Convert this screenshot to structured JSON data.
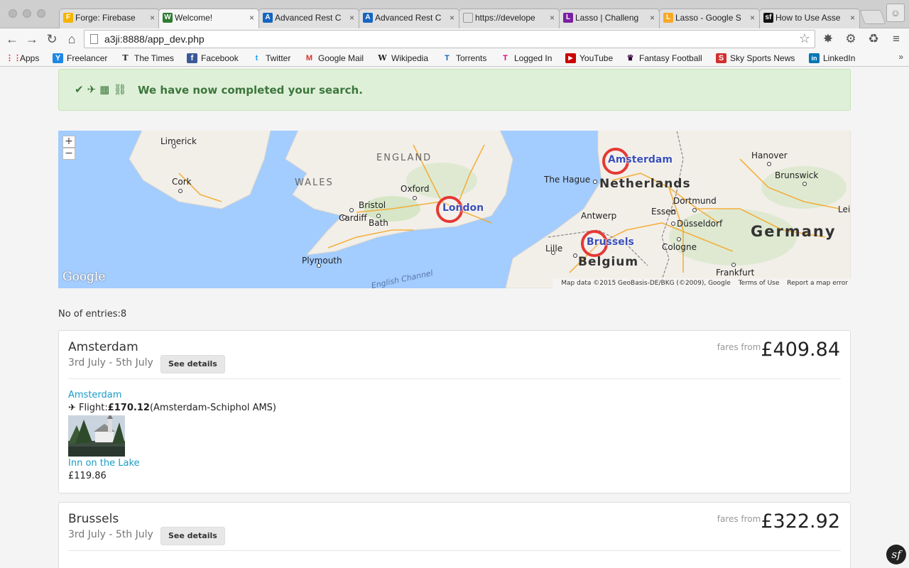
{
  "browser": {
    "tabs": [
      {
        "title": "Forge: Firebase",
        "fav": "F",
        "fav_color": "#f5b400"
      },
      {
        "title": "Welcome!",
        "fav": "W",
        "fav_color": "#2e7d32"
      },
      {
        "title": "Advanced Rest C",
        "fav": "A",
        "fav_color": "#1565c0"
      },
      {
        "title": "Advanced Rest C",
        "fav": "A",
        "fav_color": "#1565c0"
      },
      {
        "title": "https://develope",
        "fav": "",
        "fav_color": "#ffffff"
      },
      {
        "title": "Lasso | Challeng",
        "fav": "L",
        "fav_color": "#7b1fa2"
      },
      {
        "title": "Lasso - Google S",
        "fav": "L",
        "fav_color": "#f9a825"
      },
      {
        "title": "How to Use Asse",
        "fav": "sf",
        "fav_color": "#111111"
      }
    ],
    "close_glyph": "×",
    "url": "a3ji:8888/app_dev.php",
    "bookmarks": [
      {
        "label": "Apps",
        "icon": "apps-icon",
        "glyph": "⋮⋮",
        "color": "#e53935"
      },
      {
        "label": "Freelancer",
        "icon": "freelancer-icon",
        "glyph": "Y",
        "color": "#1e88e5"
      },
      {
        "label": "The Times",
        "icon": "times-icon",
        "glyph": "T",
        "color": "#222222"
      },
      {
        "label": "Facebook",
        "icon": "facebook-icon",
        "glyph": "f",
        "color": "#3b5998"
      },
      {
        "label": "Twitter",
        "icon": "twitter-icon",
        "glyph": "t",
        "color": "#1da1f2"
      },
      {
        "label": "Google Mail",
        "icon": "gmail-icon",
        "glyph": "M",
        "color": "#d93025"
      },
      {
        "label": "Wikipedia",
        "icon": "wikipedia-icon",
        "glyph": "W",
        "color": "#222222"
      },
      {
        "label": "Torrents",
        "icon": "torrents-icon",
        "glyph": "T",
        "color": "#1565c0"
      },
      {
        "label": "Logged In",
        "icon": "loggedin-icon",
        "glyph": "T",
        "color": "#e2007a"
      },
      {
        "label": "YouTube",
        "icon": "youtube-icon",
        "glyph": "▶",
        "color": "#cc0000"
      },
      {
        "label": "Fantasy Football",
        "icon": "fantasy-football-icon",
        "glyph": "♛",
        "color": "#37003c"
      },
      {
        "label": "Sky Sports News",
        "icon": "sky-sports-icon",
        "glyph": "S",
        "color": "#d32f2f"
      },
      {
        "label": "LinkedIn",
        "icon": "linkedin-icon",
        "glyph": "in",
        "color": "#0077b5"
      }
    ],
    "more_glyph": "»"
  },
  "page": {
    "alert_text": "We have now completed your search.",
    "entries_label": "No of entries:8",
    "map": {
      "zoom_in": "+",
      "zoom_out": "−",
      "labels": {
        "limerick": "Limerick",
        "cork": "Cork",
        "wales": "WALES",
        "england": "ENGLAND",
        "oxford": "Oxford",
        "bristol": "Bristol",
        "cardiff": "Cardiff",
        "bath": "Bath",
        "plymouth": "Plymouth",
        "english_channel": "English Channel",
        "the_hague": "The Hague",
        "netherlands": "Netherlands",
        "antwerp": "Antwerp",
        "lille": "Lille",
        "belgium": "Belgium",
        "hanover": "Hanover",
        "brunswick": "Brunswick",
        "dortmund": "Dortmund",
        "essen": "Essen",
        "dusseldorf": "Düsseldorf",
        "cologne": "Cologne",
        "frankfurt": "Frankfurt",
        "germany": "Germany",
        "leipzig_partial": "Lei"
      },
      "markers": {
        "london": "London",
        "amsterdam": "Amsterdam",
        "brussels": "Brussels"
      },
      "google_logo": "Google",
      "attribution": {
        "map_data": "Map data ©2015 GeoBasis-DE/BKG (©2009), Google",
        "terms": "Terms of Use",
        "report": "Report a map error"
      }
    },
    "results": [
      {
        "city": "Amsterdam",
        "dates": "3rd July - 5th July",
        "details_label": "See details",
        "fares_label": "fares from",
        "price": "£409.84",
        "destination_link": "Amsterdam",
        "flight_label": "Flight:",
        "flight_price": "£170.12",
        "flight_airport": "(Amsterdam-Schiphol AMS)",
        "hotel_name": "Inn on the Lake",
        "hotel_price": "£119.86"
      },
      {
        "city": "Brussels",
        "dates": "3rd July - 5th July",
        "details_label": "See details",
        "fares_label": "fares from",
        "price": "£322.92"
      }
    ]
  }
}
